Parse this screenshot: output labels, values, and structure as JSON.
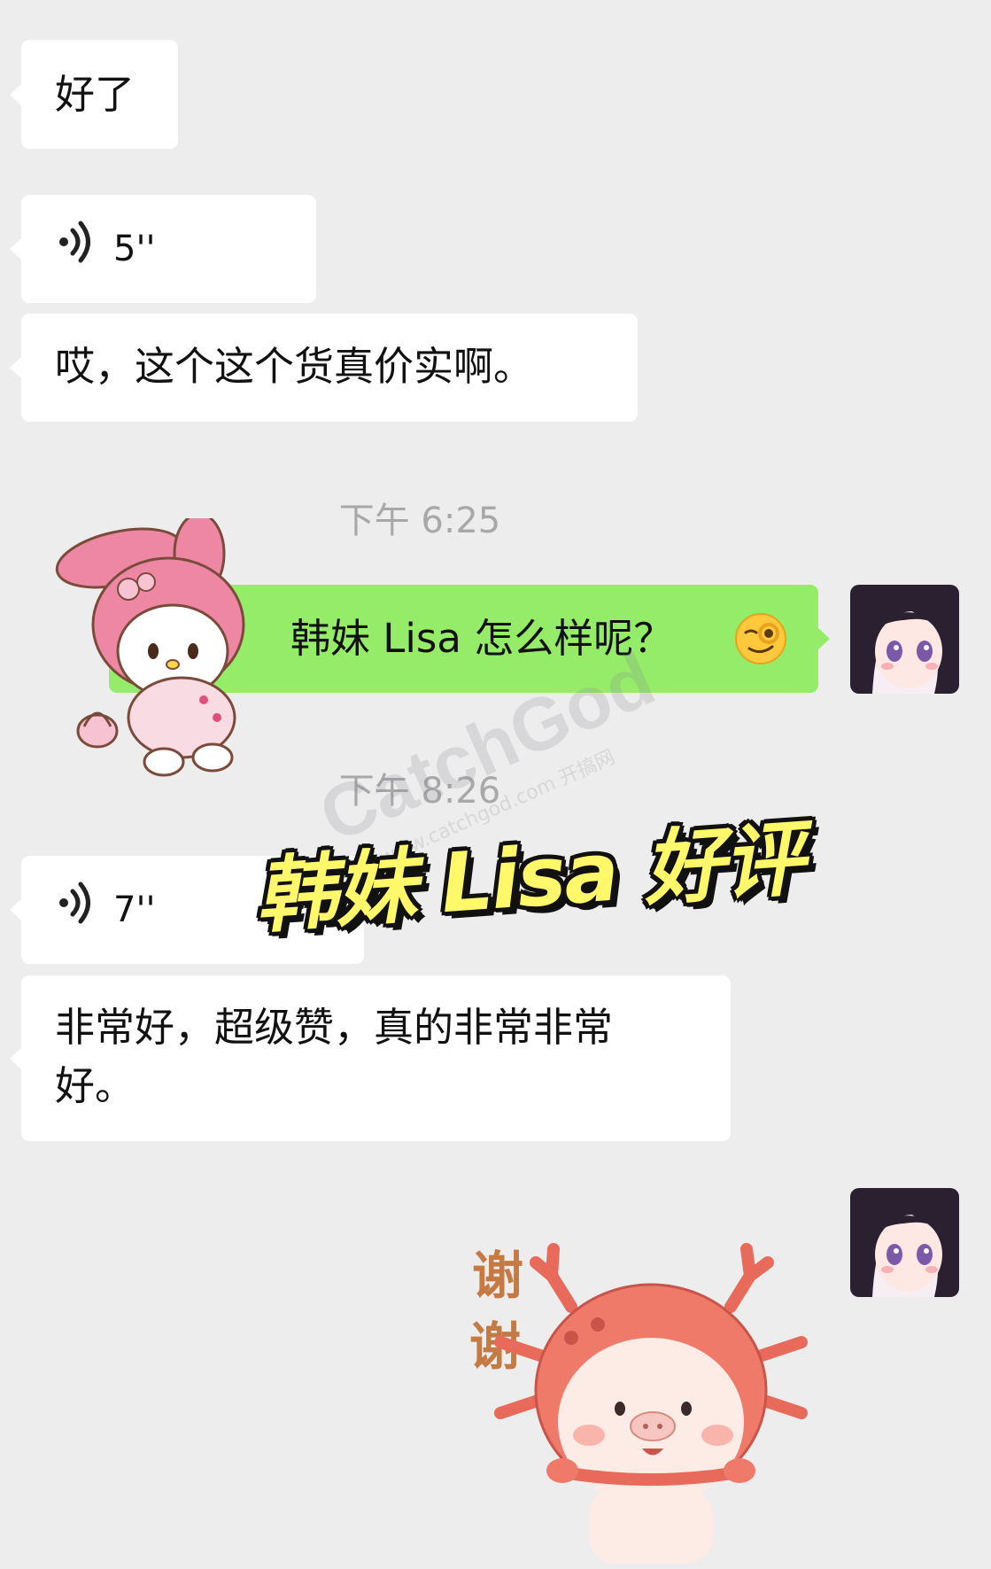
{
  "messages": {
    "m1": {
      "text": "好了"
    },
    "m2": {
      "duration": "5''"
    },
    "m3": {
      "text": "哎，这个这个货真价实啊。"
    },
    "ts1": "下午 6:25",
    "m4": {
      "text": "韩妹 Lisa 怎么样呢？"
    },
    "ts2": "下午 8:26",
    "m5": {
      "duration": "7''"
    },
    "m6": {
      "text": "非常好，超级赞，真的非常非常好。"
    }
  },
  "caption": "韩妹 Lisa 好评",
  "stickers": {
    "thanks_text": "谢\n谢"
  },
  "watermark": {
    "brand": "CatchGod",
    "site": "www.catchgod.com 开搞网"
  },
  "icons": {
    "voice": "voice-wave-icon",
    "emoji": "wink-face-emoji"
  },
  "colors": {
    "background": "#ededed",
    "bubble_in": "#ffffff",
    "bubble_out": "#95ec69",
    "caption": "#fff86a"
  }
}
